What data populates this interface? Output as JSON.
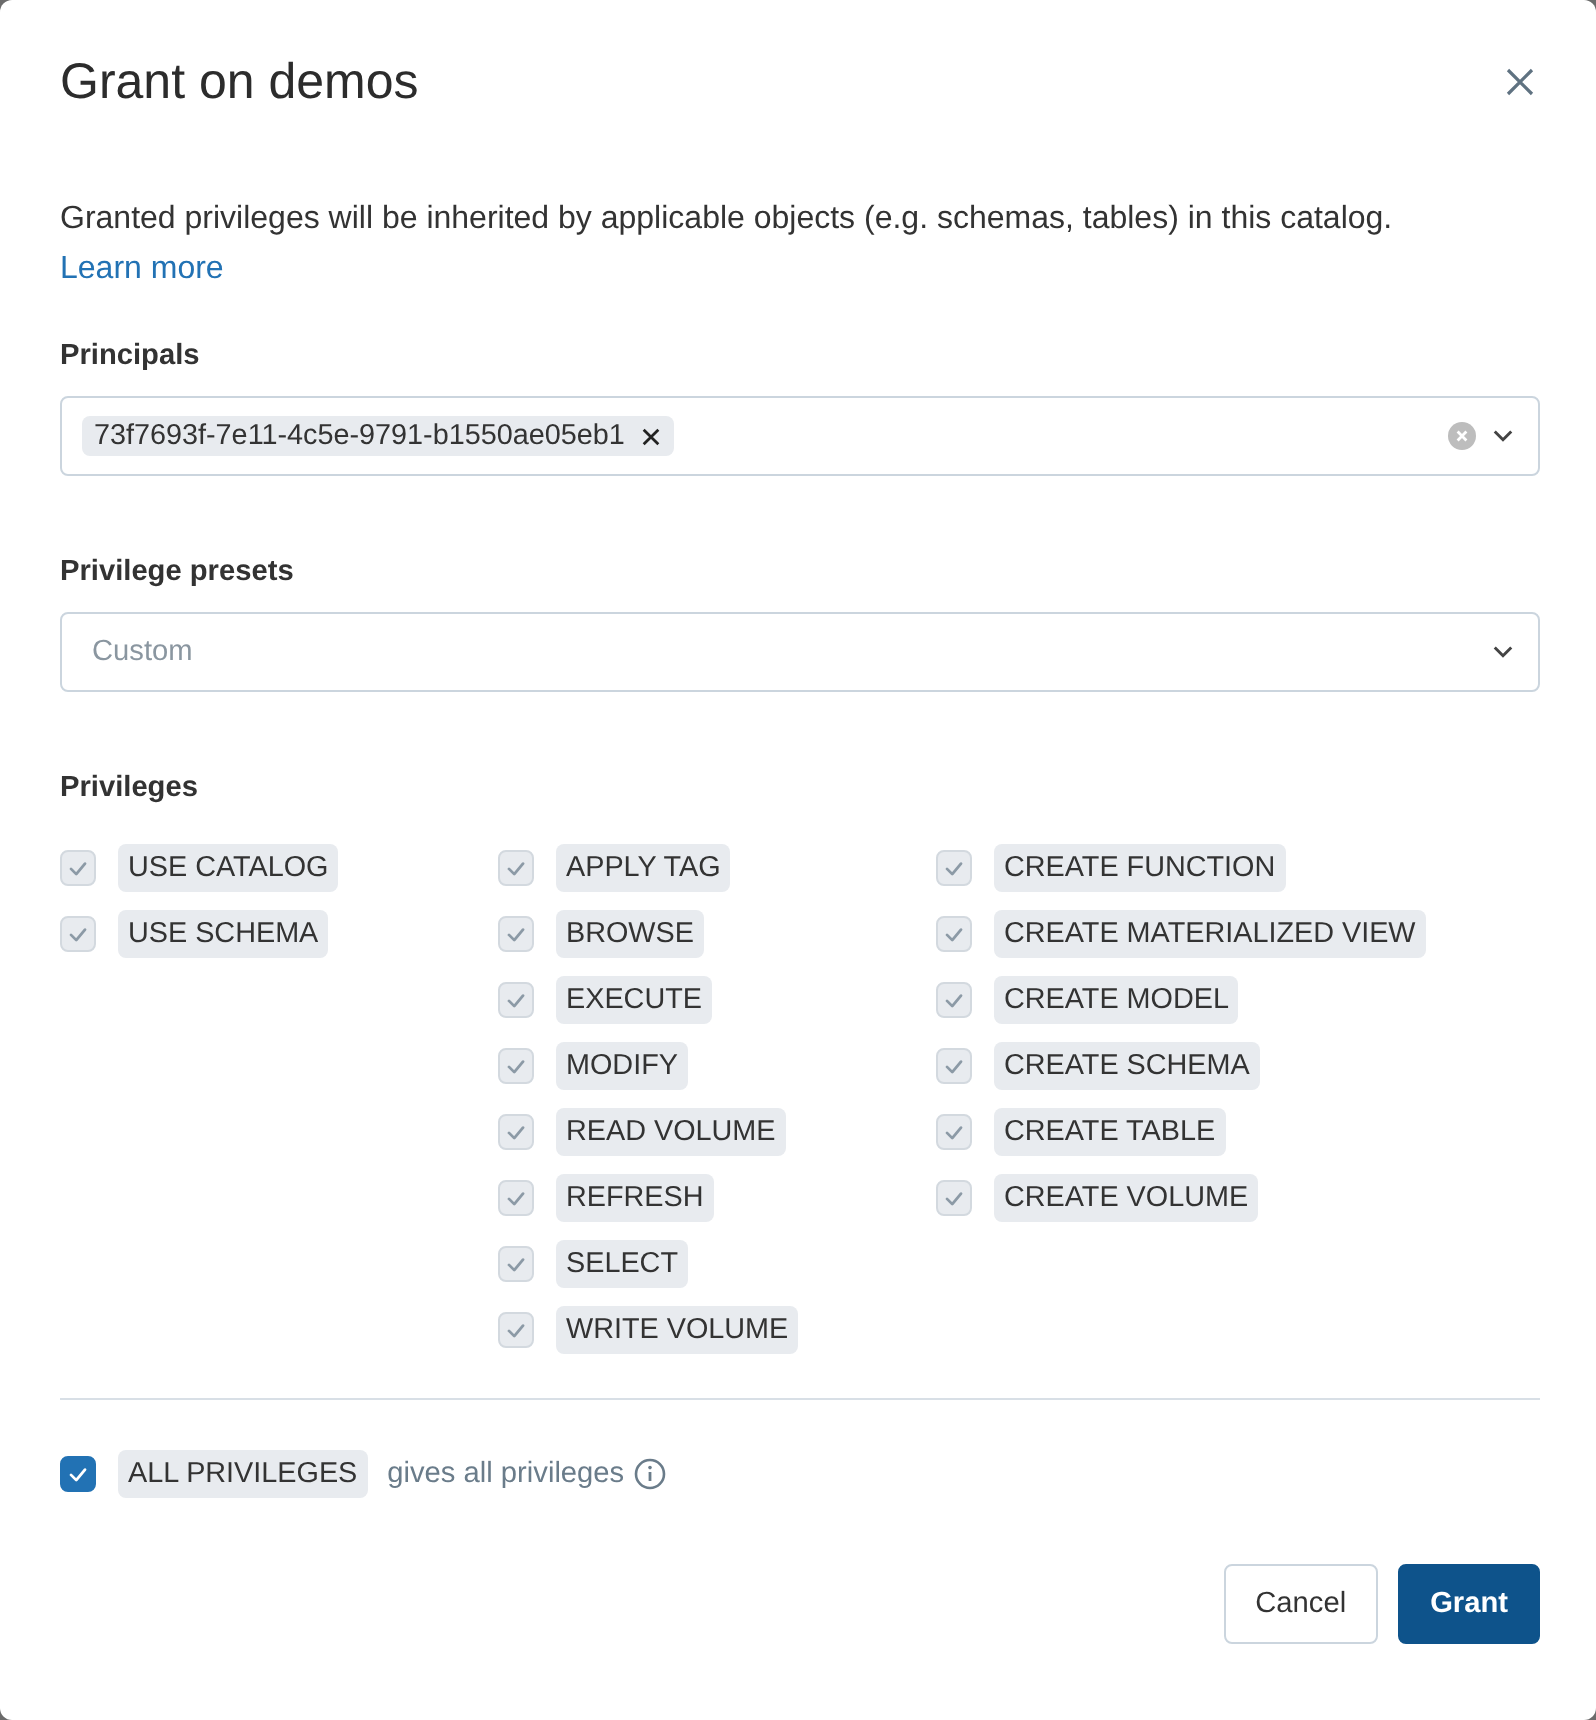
{
  "dialog": {
    "title": "Grant on demos",
    "description": "Granted privileges will be inherited by applicable objects (e.g. schemas, tables) in this catalog.",
    "link": "Learn more"
  },
  "principals": {
    "label": "Principals",
    "chips": [
      "73f7693f-7e11-4c5e-9791-b1550ae05eb1"
    ]
  },
  "presets": {
    "label": "Privilege presets",
    "placeholder": "Custom"
  },
  "privileges": {
    "label": "Privileges",
    "columns": [
      [
        {
          "label": "USE CATALOG",
          "checked": true,
          "disabled": true
        },
        {
          "label": "USE SCHEMA",
          "checked": true,
          "disabled": true
        }
      ],
      [
        {
          "label": "APPLY TAG",
          "checked": true,
          "disabled": true
        },
        {
          "label": "BROWSE",
          "checked": true,
          "disabled": true
        },
        {
          "label": "EXECUTE",
          "checked": true,
          "disabled": true
        },
        {
          "label": "MODIFY",
          "checked": true,
          "disabled": true
        },
        {
          "label": "READ VOLUME",
          "checked": true,
          "disabled": true
        },
        {
          "label": "REFRESH",
          "checked": true,
          "disabled": true
        },
        {
          "label": "SELECT",
          "checked": true,
          "disabled": true
        },
        {
          "label": "WRITE VOLUME",
          "checked": true,
          "disabled": true
        }
      ],
      [
        {
          "label": "CREATE FUNCTION",
          "checked": true,
          "disabled": true
        },
        {
          "label": "CREATE MATERIALIZED VIEW",
          "checked": true,
          "disabled": true
        },
        {
          "label": "CREATE MODEL",
          "checked": true,
          "disabled": true
        },
        {
          "label": "CREATE SCHEMA",
          "checked": true,
          "disabled": true
        },
        {
          "label": "CREATE TABLE",
          "checked": true,
          "disabled": true
        },
        {
          "label": "CREATE VOLUME",
          "checked": true,
          "disabled": true
        }
      ]
    ]
  },
  "all_privileges": {
    "label": "ALL PRIVILEGES",
    "hint": "gives all privileges",
    "checked": true,
    "disabled": false
  },
  "buttons": [
    {
      "label": "Cancel",
      "kind": "secondary"
    },
    {
      "label": "Grant",
      "kind": "primary"
    }
  ]
}
